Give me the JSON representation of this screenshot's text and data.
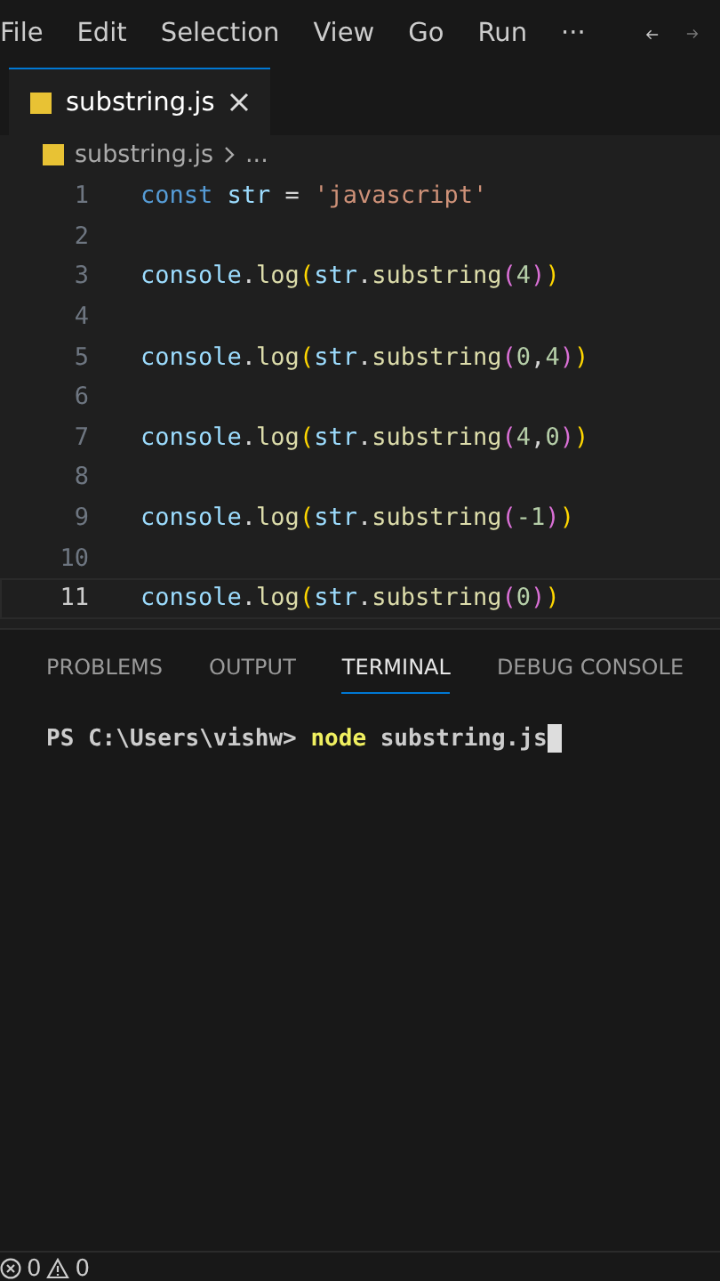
{
  "menu_bar": {
    "items": [
      "File",
      "Edit",
      "Selection",
      "View",
      "Go",
      "Run",
      "···"
    ]
  },
  "tabs": [
    {
      "label": "substring.js",
      "selected": true
    }
  ],
  "breadcrumb": {
    "file": "substring.js",
    "rest": "..."
  },
  "editor": {
    "lines": [
      {
        "number": "1",
        "selected": false,
        "tokens": [
          {
            "text": "const ",
            "kind": "keyword"
          },
          {
            "text": "str",
            "kind": "variable"
          },
          {
            "text": " = ",
            "kind": "operator"
          },
          {
            "text": "'javascript'",
            "kind": "string"
          }
        ]
      },
      {
        "number": "2",
        "selected": false
      },
      {
        "number": "3",
        "selected": false,
        "tokens": [
          {
            "text": "console",
            "kind": "variable"
          },
          {
            "text": ".",
            "kind": "operator"
          },
          {
            "text": "log",
            "kind": "function"
          },
          {
            "text": "(",
            "kind": "bracket1"
          },
          {
            "text": "str",
            "kind": "variable"
          },
          {
            "text": ".",
            "kind": "operator"
          },
          {
            "text": "substring",
            "kind": "function"
          },
          {
            "text": "(",
            "kind": "bracket2"
          },
          {
            "text": "4",
            "kind": "number"
          },
          {
            "text": ")",
            "kind": "bracket2"
          },
          {
            "text": ")",
            "kind": "bracket1"
          }
        ]
      },
      {
        "number": "4",
        "selected": false
      },
      {
        "number": "5",
        "selected": false,
        "tokens": [
          {
            "text": "console",
            "kind": "variable"
          },
          {
            "text": ".",
            "kind": "operator"
          },
          {
            "text": "log",
            "kind": "function"
          },
          {
            "text": "(",
            "kind": "bracket1"
          },
          {
            "text": "str",
            "kind": "variable"
          },
          {
            "text": ".",
            "kind": "operator"
          },
          {
            "text": "substring",
            "kind": "function"
          },
          {
            "text": "(",
            "kind": "bracket2"
          },
          {
            "text": "0",
            "kind": "number"
          },
          {
            "text": ",",
            "kind": "operator"
          },
          {
            "text": "4",
            "kind": "number"
          },
          {
            "text": ")",
            "kind": "bracket2"
          },
          {
            "text": ")",
            "kind": "bracket1"
          }
        ]
      },
      {
        "number": "6",
        "selected": false
      },
      {
        "number": "7",
        "selected": false,
        "tokens": [
          {
            "text": "console",
            "kind": "variable"
          },
          {
            "text": ".",
            "kind": "operator"
          },
          {
            "text": "log",
            "kind": "function"
          },
          {
            "text": "(",
            "kind": "bracket1"
          },
          {
            "text": "str",
            "kind": "variable"
          },
          {
            "text": ".",
            "kind": "operator"
          },
          {
            "text": "substring",
            "kind": "function"
          },
          {
            "text": "(",
            "kind": "bracket2"
          },
          {
            "text": "4",
            "kind": "number"
          },
          {
            "text": ",",
            "kind": "operator"
          },
          {
            "text": "0",
            "kind": "number"
          },
          {
            "text": ")",
            "kind": "bracket2"
          },
          {
            "text": ")",
            "kind": "bracket1"
          }
        ]
      },
      {
        "number": "8",
        "selected": false
      },
      {
        "number": "9",
        "selected": false,
        "tokens": [
          {
            "text": "console",
            "kind": "variable"
          },
          {
            "text": ".",
            "kind": "operator"
          },
          {
            "text": "log",
            "kind": "function"
          },
          {
            "text": "(",
            "kind": "bracket1"
          },
          {
            "text": "str",
            "kind": "variable"
          },
          {
            "text": ".",
            "kind": "operator"
          },
          {
            "text": "substring",
            "kind": "function"
          },
          {
            "text": "(",
            "kind": "bracket2"
          },
          {
            "text": "-1",
            "kind": "number"
          },
          {
            "text": ")",
            "kind": "bracket2"
          },
          {
            "text": ")",
            "kind": "bracket1"
          }
        ]
      },
      {
        "number": "10",
        "selected": false
      },
      {
        "number": "11",
        "selected": true,
        "tokens": [
          {
            "text": "console",
            "kind": "variable"
          },
          {
            "text": ".",
            "kind": "operator"
          },
          {
            "text": "log",
            "kind": "function"
          },
          {
            "text": "(",
            "kind": "bracket1"
          },
          {
            "text": "str",
            "kind": "variable"
          },
          {
            "text": ".",
            "kind": "operator"
          },
          {
            "text": "substring",
            "kind": "function"
          },
          {
            "text": "(",
            "kind": "bracket2"
          },
          {
            "text": "0",
            "kind": "number"
          },
          {
            "text": ")",
            "kind": "bracket2"
          },
          {
            "text": ")",
            "kind": "bracket1"
          }
        ]
      }
    ]
  },
  "panel_tabs": [
    {
      "label": "PROBLEMS",
      "selected": false
    },
    {
      "label": "OUTPUT",
      "selected": false
    },
    {
      "label": "TERMINAL",
      "selected": true
    },
    {
      "label": "DEBUG CONSOLE",
      "selected": false
    }
  ],
  "terminal": {
    "tokens": [
      {
        "text": "PS C:\\Users\\vishw> ",
        "kind": "plain"
      },
      {
        "text": "node",
        "kind": "command"
      },
      {
        "text": " substring.js",
        "kind": "plain"
      }
    ]
  },
  "status_bar": {
    "errors": "0",
    "warnings": "0"
  }
}
